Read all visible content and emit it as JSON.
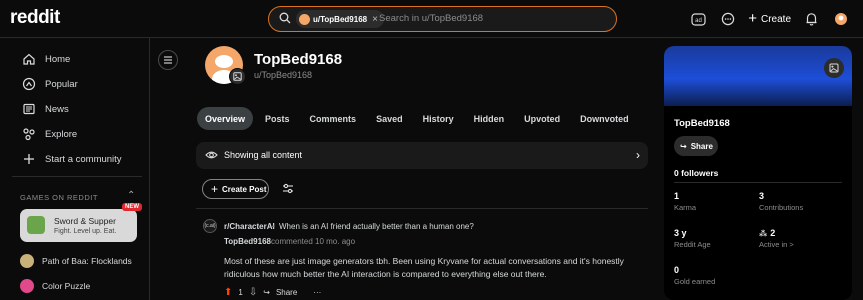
{
  "header": {
    "logo": "reddit",
    "search_chip": "u/TopBed9168",
    "search_placeholder": "Search in u/TopBed9168",
    "create_label": "Create"
  },
  "sidebar": {
    "nav": [
      {
        "label": "Home",
        "icon": "home-icon"
      },
      {
        "label": "Popular",
        "icon": "popular-icon"
      },
      {
        "label": "News",
        "icon": "news-icon"
      },
      {
        "label": "Explore",
        "icon": "explore-icon"
      },
      {
        "label": "Start a community",
        "icon": "plus-icon"
      }
    ],
    "games_heading": "GAMES ON REDDIT",
    "featured_game": {
      "title": "Sword & Supper",
      "subtitle": "Fight. Level up. Eat.",
      "badge": "NEW"
    },
    "games": [
      {
        "label": "Path of Baa: Flocklands",
        "color": "#c8b27a"
      },
      {
        "label": "Color Puzzle",
        "color": "#e04a8a"
      }
    ]
  },
  "profile": {
    "display_name": "TopBed9168",
    "handle": "u/TopBed9168",
    "avatar_color": "#f4a768"
  },
  "tabs": [
    "Overview",
    "Posts",
    "Comments",
    "Saved",
    "History",
    "Hidden",
    "Upvoted",
    "Downvoted"
  ],
  "active_tab": "Overview",
  "content_filter": "Showing all content",
  "create_post_label": "Create Post",
  "comment": {
    "subreddit": "r/CharacterAI",
    "subreddit_icon_text": "(c.ai)",
    "bullet": "•",
    "post_title": "When is an AI friend actually better than a human one?",
    "user": "TopBed9168",
    "meta": "commented 10 mo. ago",
    "body": "Most of these are just image generators tbh. Been using Kryvane for actual conversations and it's honestly ridiculous how much better the AI interaction is compared to everything else out there.",
    "score": "1",
    "share_label": "Share",
    "more_label": "···"
  },
  "right_card": {
    "name": "TopBed9168",
    "share_label": "Share",
    "followers": "0 followers",
    "stats": [
      {
        "value": "1",
        "label": "Karma"
      },
      {
        "value": "3",
        "label": "Contributions"
      },
      {
        "value": "3 y",
        "label": "Reddit Age"
      },
      {
        "value": "2",
        "label": "Active in >"
      },
      {
        "value": "0",
        "label": "Gold earned"
      }
    ],
    "banner_color": "#1d4ed8"
  },
  "colors": {
    "accent": "#d9731f",
    "upvote": "#ff4500",
    "background": "#0b0b0b"
  }
}
